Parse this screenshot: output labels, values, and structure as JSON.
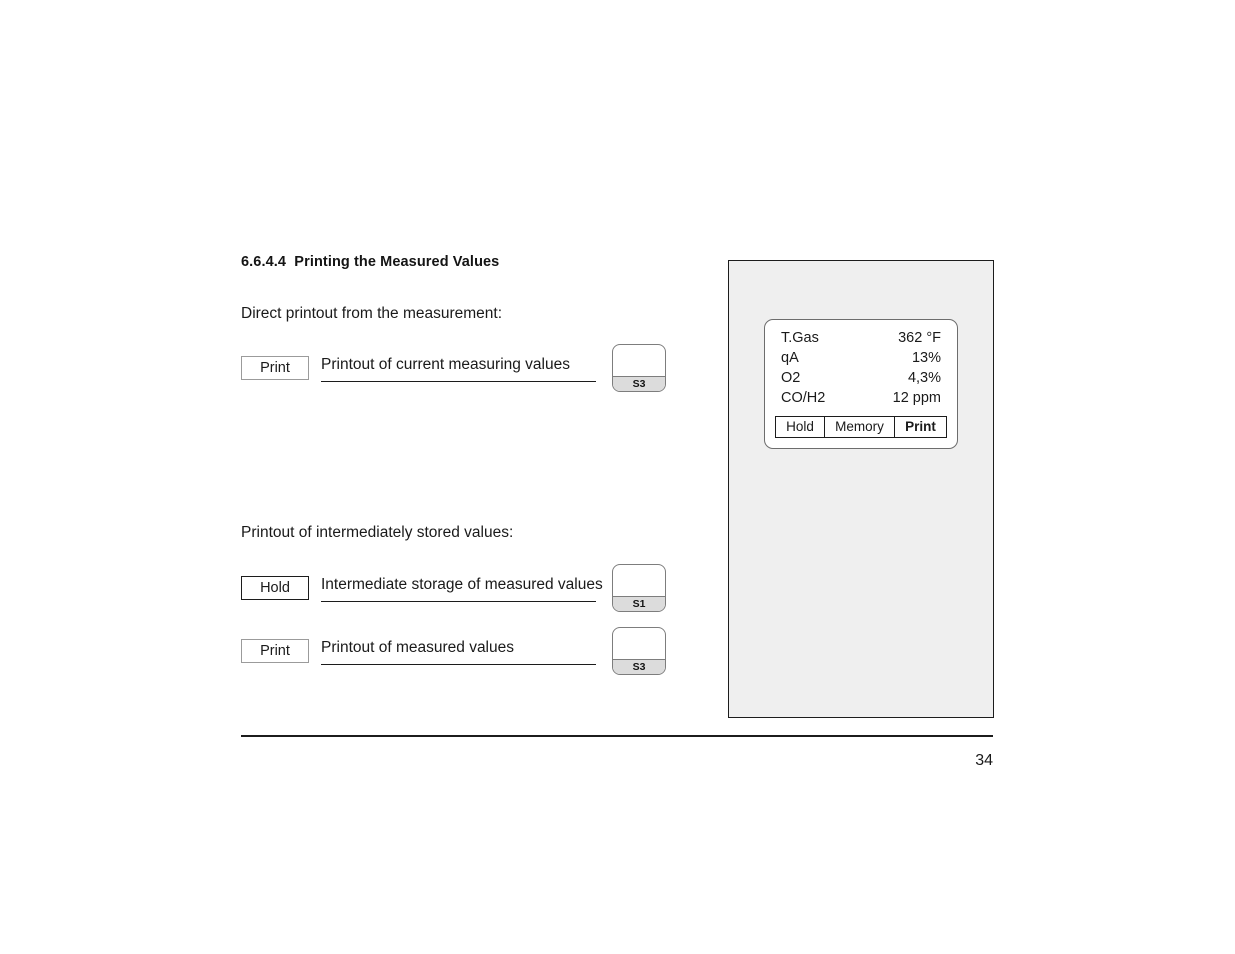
{
  "heading": {
    "number": "6.6.4.4",
    "title": "Printing the Measured Values",
    "full": "6.6.4.4  Printing the Measured Values"
  },
  "sections": [
    {
      "intro": "Direct printout from the measurement:",
      "rows": [
        {
          "button_label": "Print",
          "description": "Printout of current measuring values",
          "key_label": "S3"
        }
      ]
    },
    {
      "intro": "Printout of intermediately stored values:",
      "rows": [
        {
          "button_label": "Hold",
          "description": "Intermediate storage of measured values",
          "key_label": "S1"
        },
        {
          "button_label": "Print",
          "description": "Printout of measured values",
          "key_label": "S3"
        }
      ]
    }
  ],
  "device": {
    "display": {
      "readings": [
        {
          "label": "T.Gas",
          "value": "362 °F"
        },
        {
          "label": "qA",
          "value": "13%"
        },
        {
          "label": "O2",
          "value": "4,3%"
        },
        {
          "label": "CO/H2",
          "value": "12 ppm"
        }
      ],
      "softkeys": [
        {
          "label": "Hold",
          "active": false
        },
        {
          "label": "Memory",
          "active": false
        },
        {
          "label": "Print",
          "active": true
        }
      ]
    }
  },
  "footer": {
    "page_number": "34"
  },
  "colors": {
    "ink": "#1a1a1a",
    "panel_fill": "#efefef",
    "key_band": "#dcdcdc",
    "rule": "#1c1c1c"
  }
}
